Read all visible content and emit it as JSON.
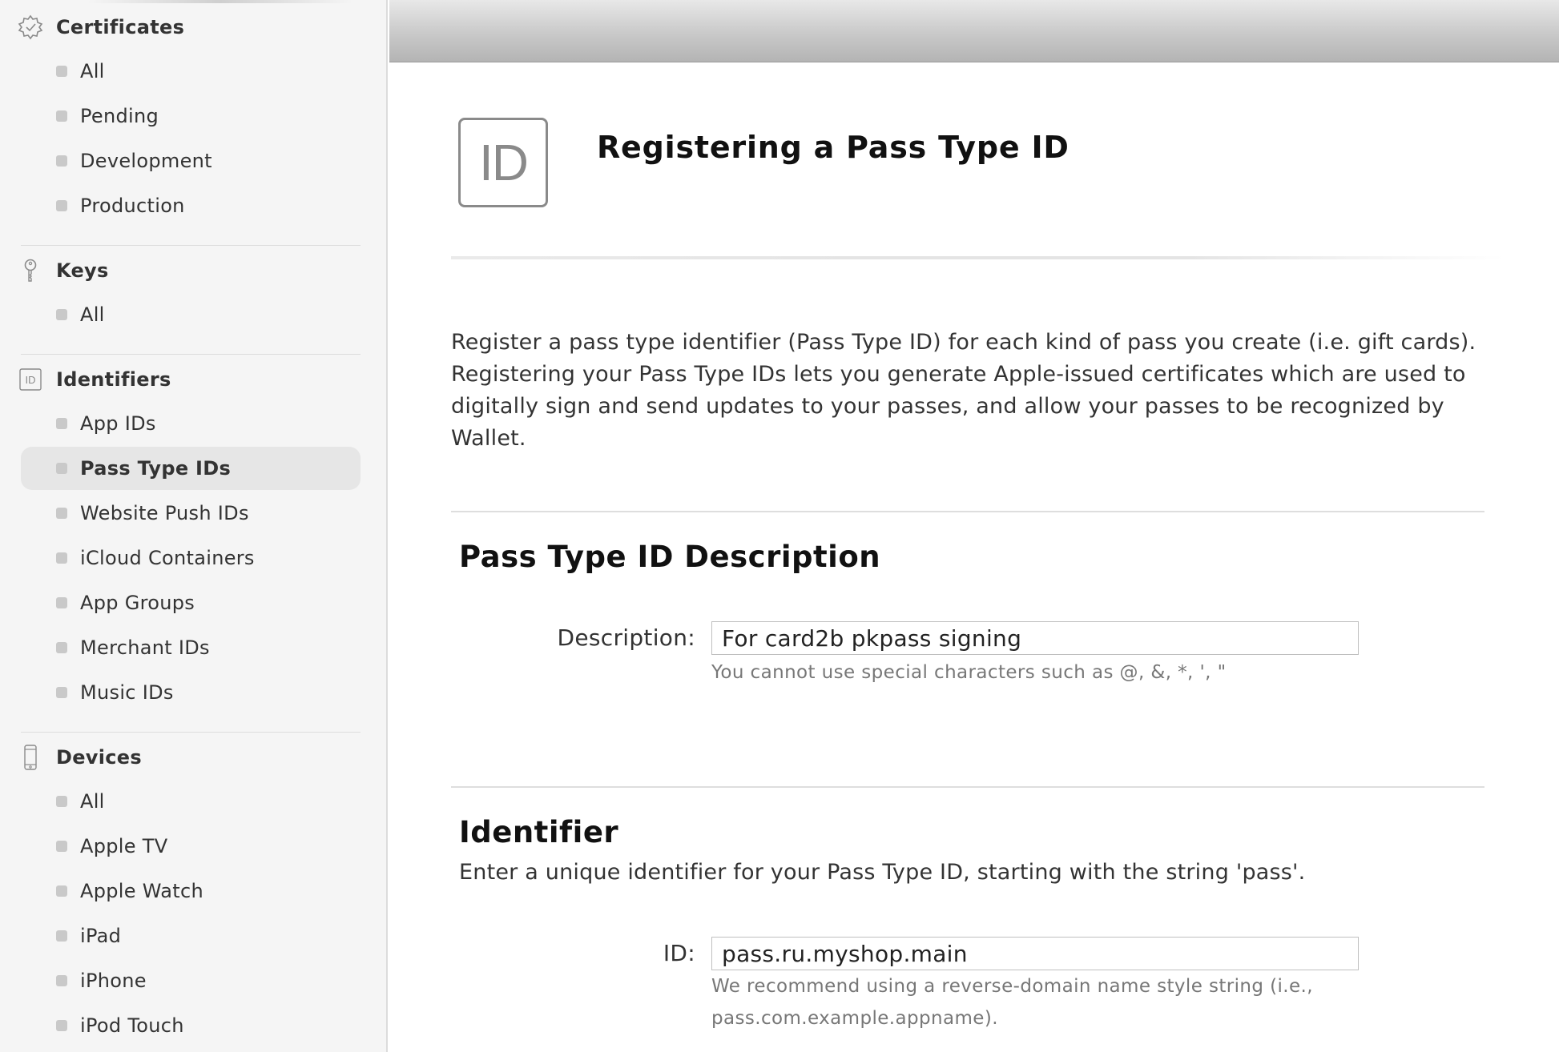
{
  "sidebar": {
    "sections": {
      "certificates": {
        "label": "Certificates",
        "icon": "certificate-badge-icon",
        "items": [
          "All",
          "Pending",
          "Development",
          "Production"
        ]
      },
      "keys": {
        "label": "Keys",
        "icon": "key-icon",
        "items": [
          "All"
        ]
      },
      "identifiers": {
        "label": "Identifiers",
        "icon": "id-icon",
        "icon_text": "ID",
        "items": [
          "App IDs",
          "Pass Type IDs",
          "Website Push IDs",
          "iCloud Containers",
          "App Groups",
          "Merchant IDs",
          "Music IDs"
        ],
        "active_item": "Pass Type IDs"
      },
      "devices": {
        "label": "Devices",
        "icon": "phone-device-icon",
        "items": [
          "All",
          "Apple TV",
          "Apple Watch",
          "iPad",
          "iPhone",
          "iPod Touch"
        ]
      }
    }
  },
  "main": {
    "badge_text": "ID",
    "title": "Registering a Pass Type ID",
    "intro": "Register a pass type identifier (Pass Type ID) for each kind of pass you create (i.e. gift cards). Registering your Pass Type IDs lets you generate Apple-issued certificates which are used to digitally sign and send updates to your passes, and allow your passes to be recognized by Wallet.",
    "description_section": {
      "title": "Pass Type ID Description",
      "label": "Description:",
      "value": "For card2b pkpass signing",
      "hint": "You cannot use special characters such as @, &, *, ', \""
    },
    "identifier_section": {
      "title": "Identifier",
      "subtitle": "Enter a unique identifier for your Pass Type ID, starting with the string 'pass'.",
      "label": "ID:",
      "value": "pass.ru.myshop.main",
      "hint_line1": "We recommend using a reverse-domain name style string (i.e.,",
      "hint_line2": "pass.com.example.appname)."
    }
  },
  "colors": {
    "sidebar_bg": "#f5f5f5",
    "active_item_bg": "#e6e6e6",
    "topbar": "#c9c9c9",
    "bullet": "#c9c9c9"
  }
}
